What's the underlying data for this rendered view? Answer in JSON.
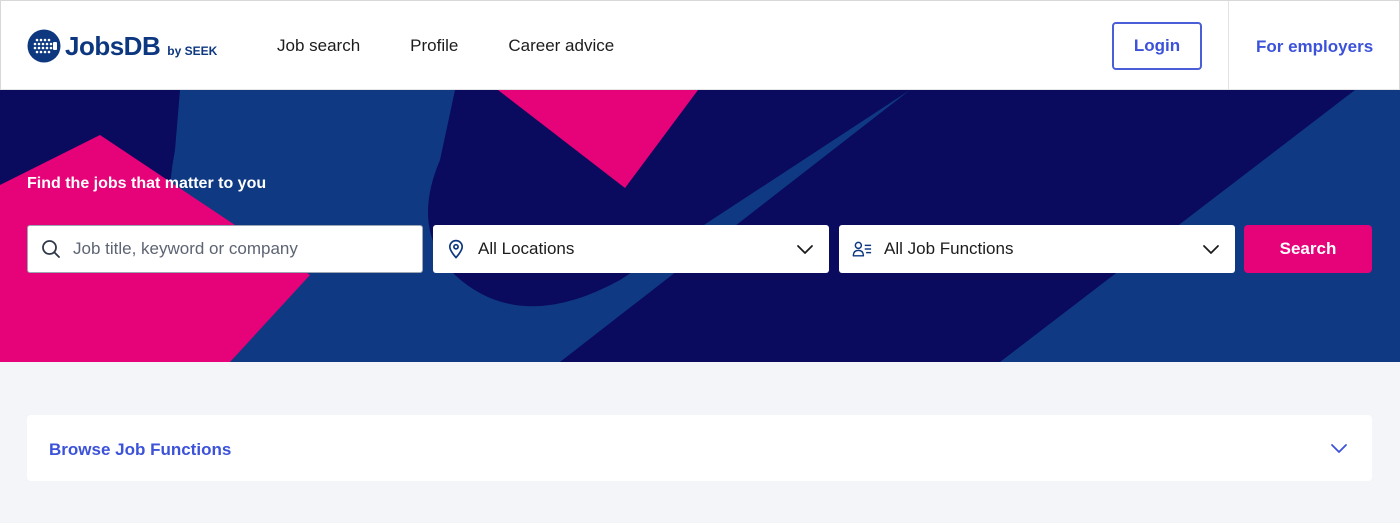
{
  "header": {
    "logo_text": "JobsDB",
    "logo_by": "by SEEK",
    "nav": [
      {
        "label": "Job search"
      },
      {
        "label": "Profile"
      },
      {
        "label": "Career advice"
      }
    ],
    "login_label": "Login",
    "employers_label": "For employers"
  },
  "hero": {
    "title": "Find the jobs that matter to you",
    "keyword_placeholder": "Job title, keyword or company",
    "location_value": "All Locations",
    "function_value": "All Job Functions",
    "search_label": "Search"
  },
  "browse": {
    "title": "Browse Job Functions"
  },
  "colors": {
    "brand_blue": "#0d3880",
    "accent_blue": "#3b52d9",
    "hero_navy": "#0a0a5e",
    "hero_mid_blue": "#0f3a83",
    "accent_pink": "#e60278"
  },
  "icons": {
    "search": "search-icon",
    "location": "location-pin-icon",
    "function": "person-list-icon",
    "dropdown": "chevron-down-icon"
  }
}
